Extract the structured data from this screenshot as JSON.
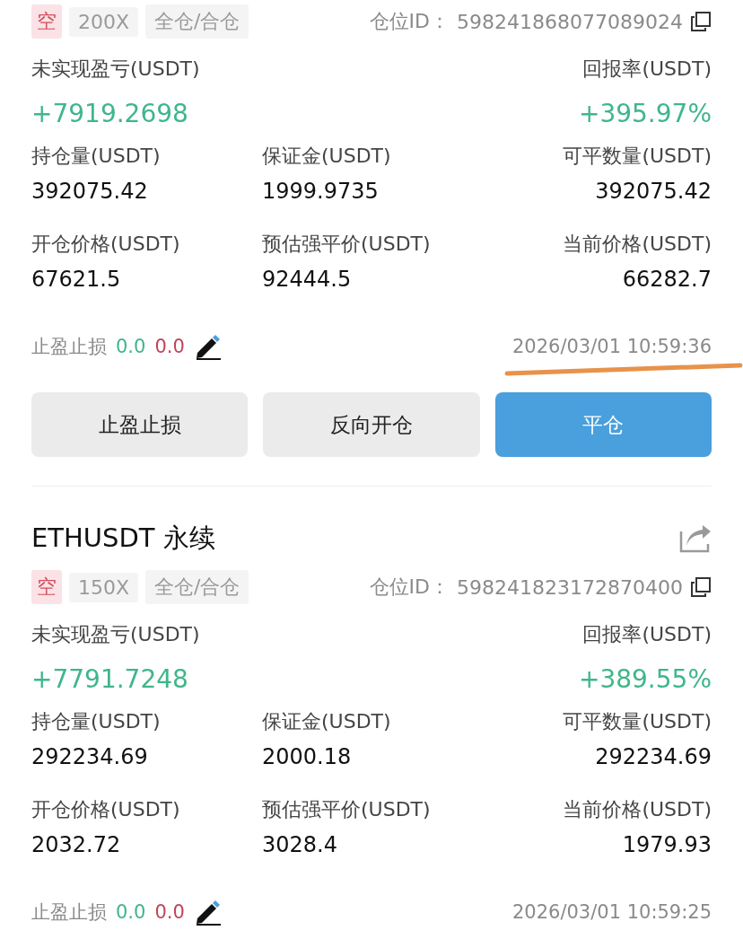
{
  "positions": [
    {
      "side": "空",
      "leverage": "200X",
      "margin_mode": "全仓/合仓",
      "position_id_label": "仓位ID：",
      "position_id": "598241868077089024",
      "pnl_label": "未实现盈亏(USDT)",
      "pnl": "+7919.2698",
      "roe_label": "回报率(USDT)",
      "roe": "+395.97%",
      "stats": [
        {
          "label": "持仓量(USDT)",
          "value": "392075.42"
        },
        {
          "label": "保证金(USDT)",
          "value": "1999.9735"
        },
        {
          "label": "可平数量(USDT)",
          "value": "392075.42"
        },
        {
          "label": "开仓价格(USDT)",
          "value": "67621.5"
        },
        {
          "label": "预估强平价(USDT)",
          "value": "92444.5"
        },
        {
          "label": "当前价格(USDT)",
          "value": "66282.7"
        }
      ],
      "tpsl_label": "止盈止损",
      "take_profit": "0.0",
      "stop_loss": "0.0",
      "time": "2026/03/01 10:59:36",
      "time_underlined": true,
      "buttons": [
        {
          "label": "止盈止损",
          "kind": "secondary"
        },
        {
          "label": "反向开仓",
          "kind": "secondary"
        },
        {
          "label": "平仓",
          "kind": "primary"
        }
      ]
    },
    {
      "symbol": "ETHUSDT 永续",
      "side": "空",
      "leverage": "150X",
      "margin_mode": "全仓/合仓",
      "position_id_label": "仓位ID：",
      "position_id": "598241823172870400",
      "pnl_label": "未实现盈亏(USDT)",
      "pnl": "+7791.7248",
      "roe_label": "回报率(USDT)",
      "roe": "+389.55%",
      "stats": [
        {
          "label": "持仓量(USDT)",
          "value": "292234.69"
        },
        {
          "label": "保证金(USDT)",
          "value": "2000.18"
        },
        {
          "label": "可平数量(USDT)",
          "value": "292234.69"
        },
        {
          "label": "开仓价格(USDT)",
          "value": "2032.72"
        },
        {
          "label": "预估强平价(USDT)",
          "value": "3028.4"
        },
        {
          "label": "当前价格(USDT)",
          "value": "1979.93"
        }
      ],
      "tpsl_label": "止盈止损",
      "take_profit": "0.0",
      "stop_loss": "0.0",
      "time": "2026/03/01 10:59:25"
    }
  ]
}
